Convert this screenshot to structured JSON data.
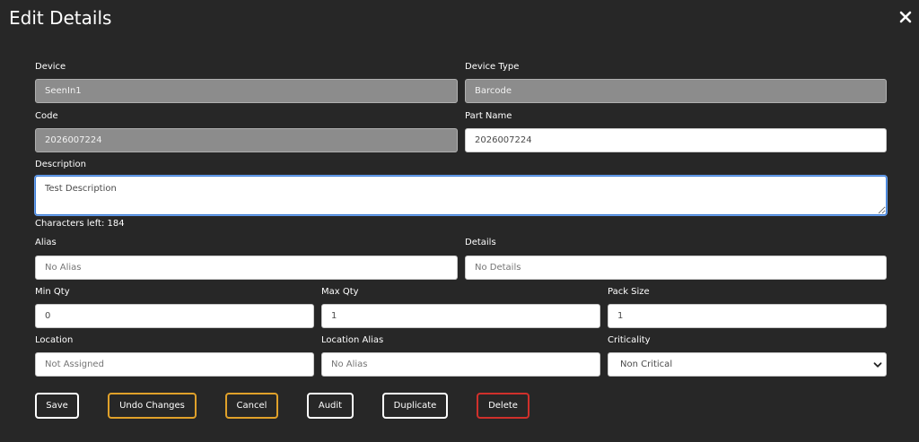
{
  "dialog": {
    "title": "Edit Details",
    "close_icon": "close-icon"
  },
  "form": {
    "device": {
      "label": "Device",
      "value": "SeenIn1"
    },
    "device_type": {
      "label": "Device Type",
      "value": "Barcode"
    },
    "code": {
      "label": "Code",
      "value": "2026007224"
    },
    "part_name": {
      "label": "Part Name",
      "value": "2026007224"
    },
    "description": {
      "label": "Description",
      "value": "Test Description"
    },
    "characters_left": "Characters left: 184",
    "alias": {
      "label": "Alias",
      "placeholder": "No Alias"
    },
    "details": {
      "label": "Details",
      "placeholder": "No Details"
    },
    "min_qty": {
      "label": "Min Qty",
      "value": "0"
    },
    "max_qty": {
      "label": "Max Qty",
      "value": "1"
    },
    "pack_size": {
      "label": "Pack Size",
      "value": "1"
    },
    "location": {
      "label": "Location",
      "placeholder": "Not Assigned"
    },
    "location_alias": {
      "label": "Location Alias",
      "placeholder": "No Alias"
    },
    "criticality": {
      "label": "Criticality",
      "selected": "Non Critical"
    }
  },
  "buttons": {
    "save": "Save",
    "undo": "Undo Changes",
    "cancel": "Cancel",
    "audit": "Audit",
    "duplicate": "Duplicate",
    "delete": "Delete"
  },
  "colors": {
    "background": "#272727",
    "warning_border": "#e0a12a",
    "danger_border": "#d0302b",
    "focus_border": "#3a7bd5"
  }
}
